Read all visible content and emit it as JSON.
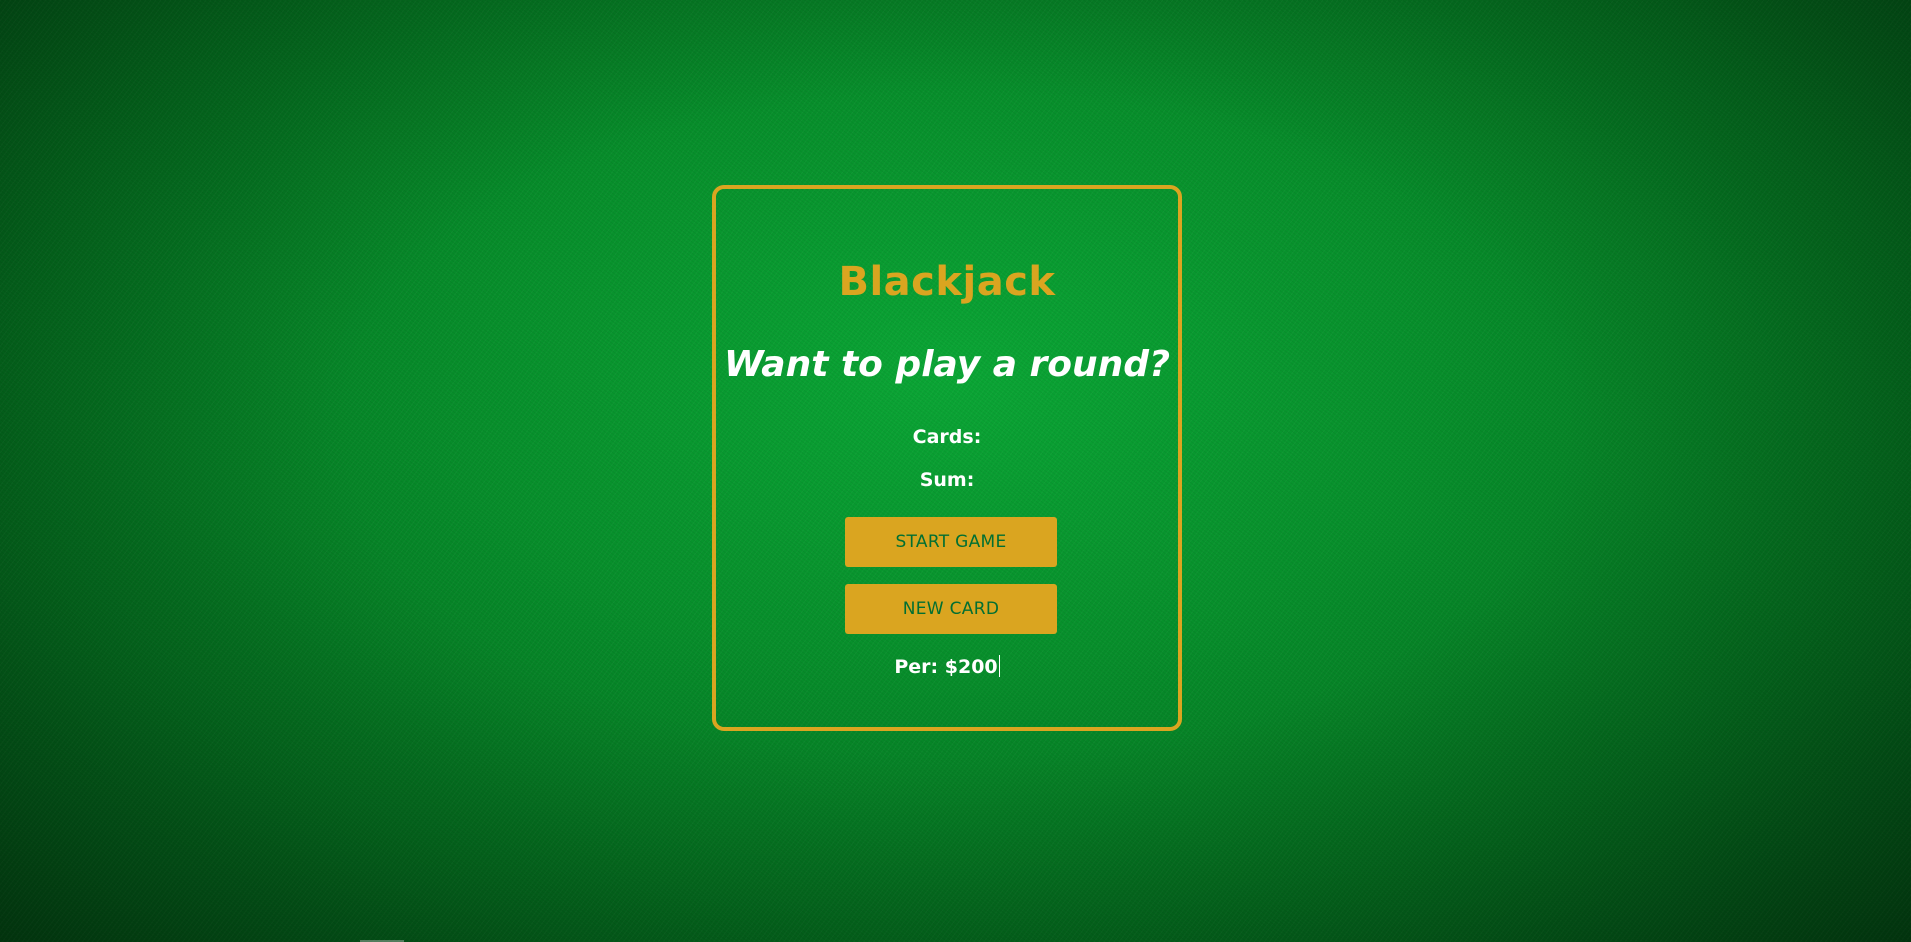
{
  "game": {
    "title": "Blackjack",
    "message": "Want to play a round?",
    "cards_label": "Cards:",
    "sum_label": "Sum:",
    "start_button_label": "START GAME",
    "new_card_button_label": "NEW CARD",
    "player_text": "Per: $200"
  },
  "colors": {
    "accent": "#daa520",
    "felt": "#078f2b",
    "button_text": "#016f32",
    "text": "#ffffff"
  }
}
